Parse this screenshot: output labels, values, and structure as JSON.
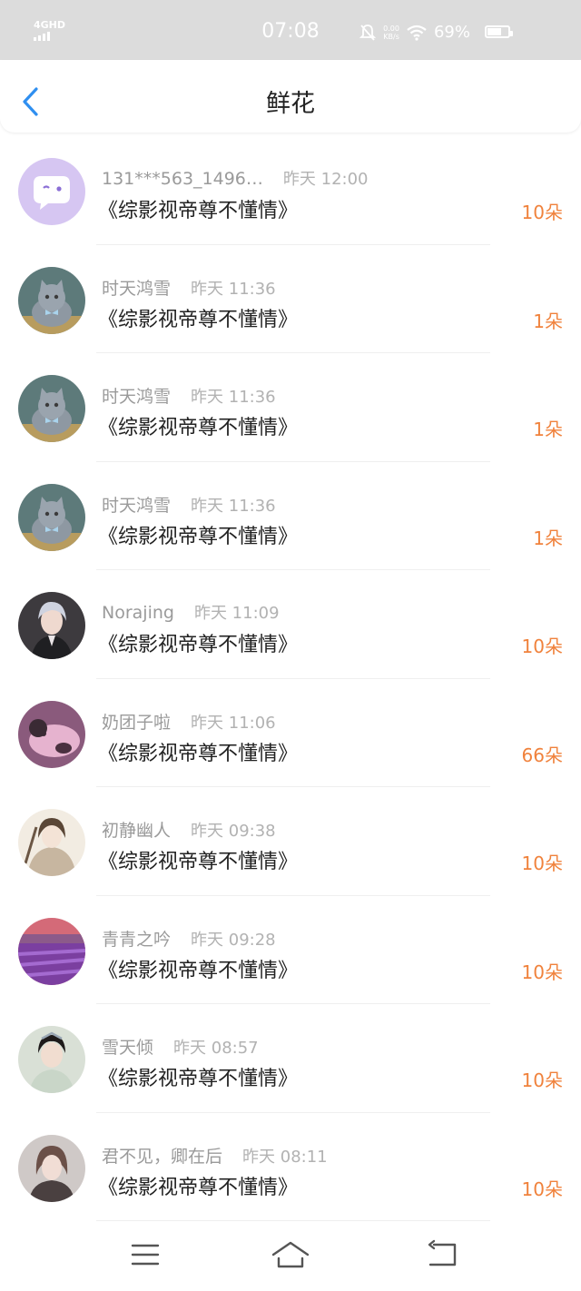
{
  "status_bar": {
    "network": "4GHD",
    "time": "07:08",
    "speed": "0.00",
    "speed_unit": "KB/s",
    "battery": "69%",
    "battery_level": 0.69
  },
  "header": {
    "title": "鲜花"
  },
  "gifts": [
    {
      "name": "131***563_1496…",
      "time": "昨天 12:00",
      "book": "《综影视帝尊不懂情》",
      "amount": "10朵",
      "avatar": "message-bubble-avatar"
    },
    {
      "name": "时天鸿雪",
      "time": "昨天 11:36",
      "book": "《综影视帝尊不懂情》",
      "amount": "1朵",
      "avatar": "gray-cat-avatar"
    },
    {
      "name": "时天鸿雪",
      "time": "昨天 11:36",
      "book": "《综影视帝尊不懂情》",
      "amount": "1朵",
      "avatar": "gray-cat-avatar"
    },
    {
      "name": "时天鸿雪",
      "time": "昨天 11:36",
      "book": "《综影视帝尊不懂情》",
      "amount": "1朵",
      "avatar": "gray-cat-avatar"
    },
    {
      "name": "Norajing",
      "time": "昨天 11:09",
      "book": "《综影视帝尊不懂情》",
      "amount": "10朵",
      "avatar": "anime-man-avatar"
    },
    {
      "name": "奶团子啦",
      "time": "昨天 11:06",
      "book": "《综影视帝尊不懂情》",
      "amount": "66朵",
      "avatar": "pink-panda-avatar"
    },
    {
      "name": "初静幽人",
      "time": "昨天 09:38",
      "book": "《综影视帝尊不懂情》",
      "amount": "10朵",
      "avatar": "ancient-girl-avatar"
    },
    {
      "name": "青青之吟",
      "time": "昨天 09:28",
      "book": "《综影视帝尊不懂情》",
      "amount": "10朵",
      "avatar": "lavender-field-avatar"
    },
    {
      "name": "雪天倾",
      "time": "昨天 08:57",
      "book": "《综影视帝尊不懂情》",
      "amount": "10朵",
      "avatar": "costume-woman-avatar"
    },
    {
      "name": "君不见，卿在后",
      "time": "昨天 08:11",
      "book": "《综影视帝尊不懂情》",
      "amount": "10朵",
      "avatar": "woman-portrait-avatar"
    }
  ],
  "colors": {
    "accent": "#2f8ff0",
    "amount": "#f0823c",
    "status_bar": "#dcdcdc"
  },
  "nav_bar": {
    "icons": [
      "menu-icon",
      "home-icon",
      "back-icon"
    ]
  }
}
